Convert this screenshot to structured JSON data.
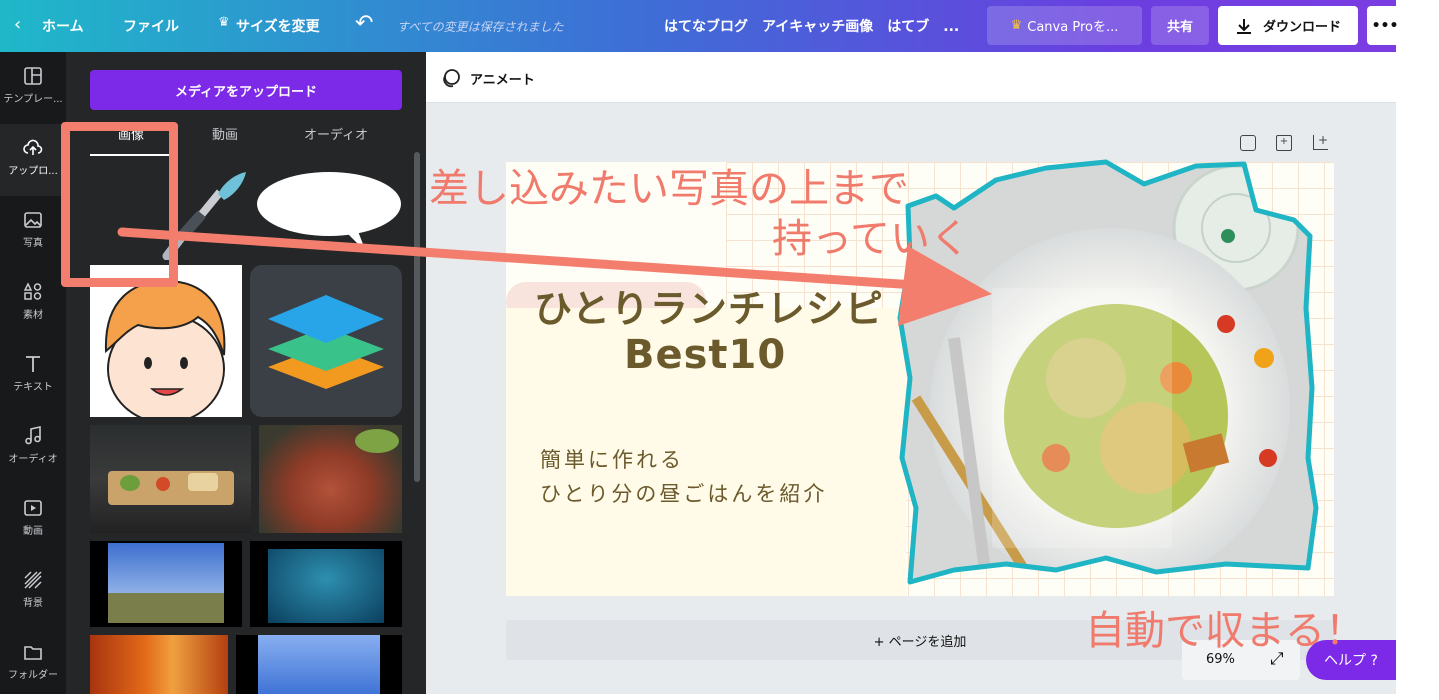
{
  "topbar": {
    "home": "ホーム",
    "file": "ファイル",
    "resize": "サイズを変更",
    "saved_status": "すべての変更は保存されました",
    "doc_title": "はてなブログ　アイキャッチ画像　はてブ　...",
    "canva_pro": "Canva Proを...",
    "share": "共有",
    "download": "ダウンロード",
    "more": "•••"
  },
  "rail": {
    "items": [
      "テンプレー...",
      "アップロ...",
      "写真",
      "素材",
      "テキスト",
      "オーディオ",
      "動画",
      "背景",
      "フォルダー"
    ]
  },
  "panel": {
    "upload_button": "メディアをアップロード",
    "tabs": [
      "画像",
      "動画",
      "オーディオ"
    ]
  },
  "toolbar": {
    "animate": "アニメート"
  },
  "design": {
    "title_line1": "ひとりランチレシピ",
    "title_line2": "Best10",
    "sub_line1": "簡単に作れる",
    "sub_line2": "ひとり分の昼ごはんを紹介"
  },
  "annotations": {
    "drag_line1": "差し込みたい写真の上まで",
    "drag_line2": "持っていく",
    "auto_fit": "自動で収まる！"
  },
  "footer": {
    "add_page": "+ ページを追加",
    "zoom": "69%",
    "help": "ヘルプ ?"
  },
  "colors": {
    "upload_button": "#7d2ae8",
    "annotation": "#f07a6c",
    "frame_outline": "#1fb5c4",
    "title_text": "#6b5a2c"
  }
}
